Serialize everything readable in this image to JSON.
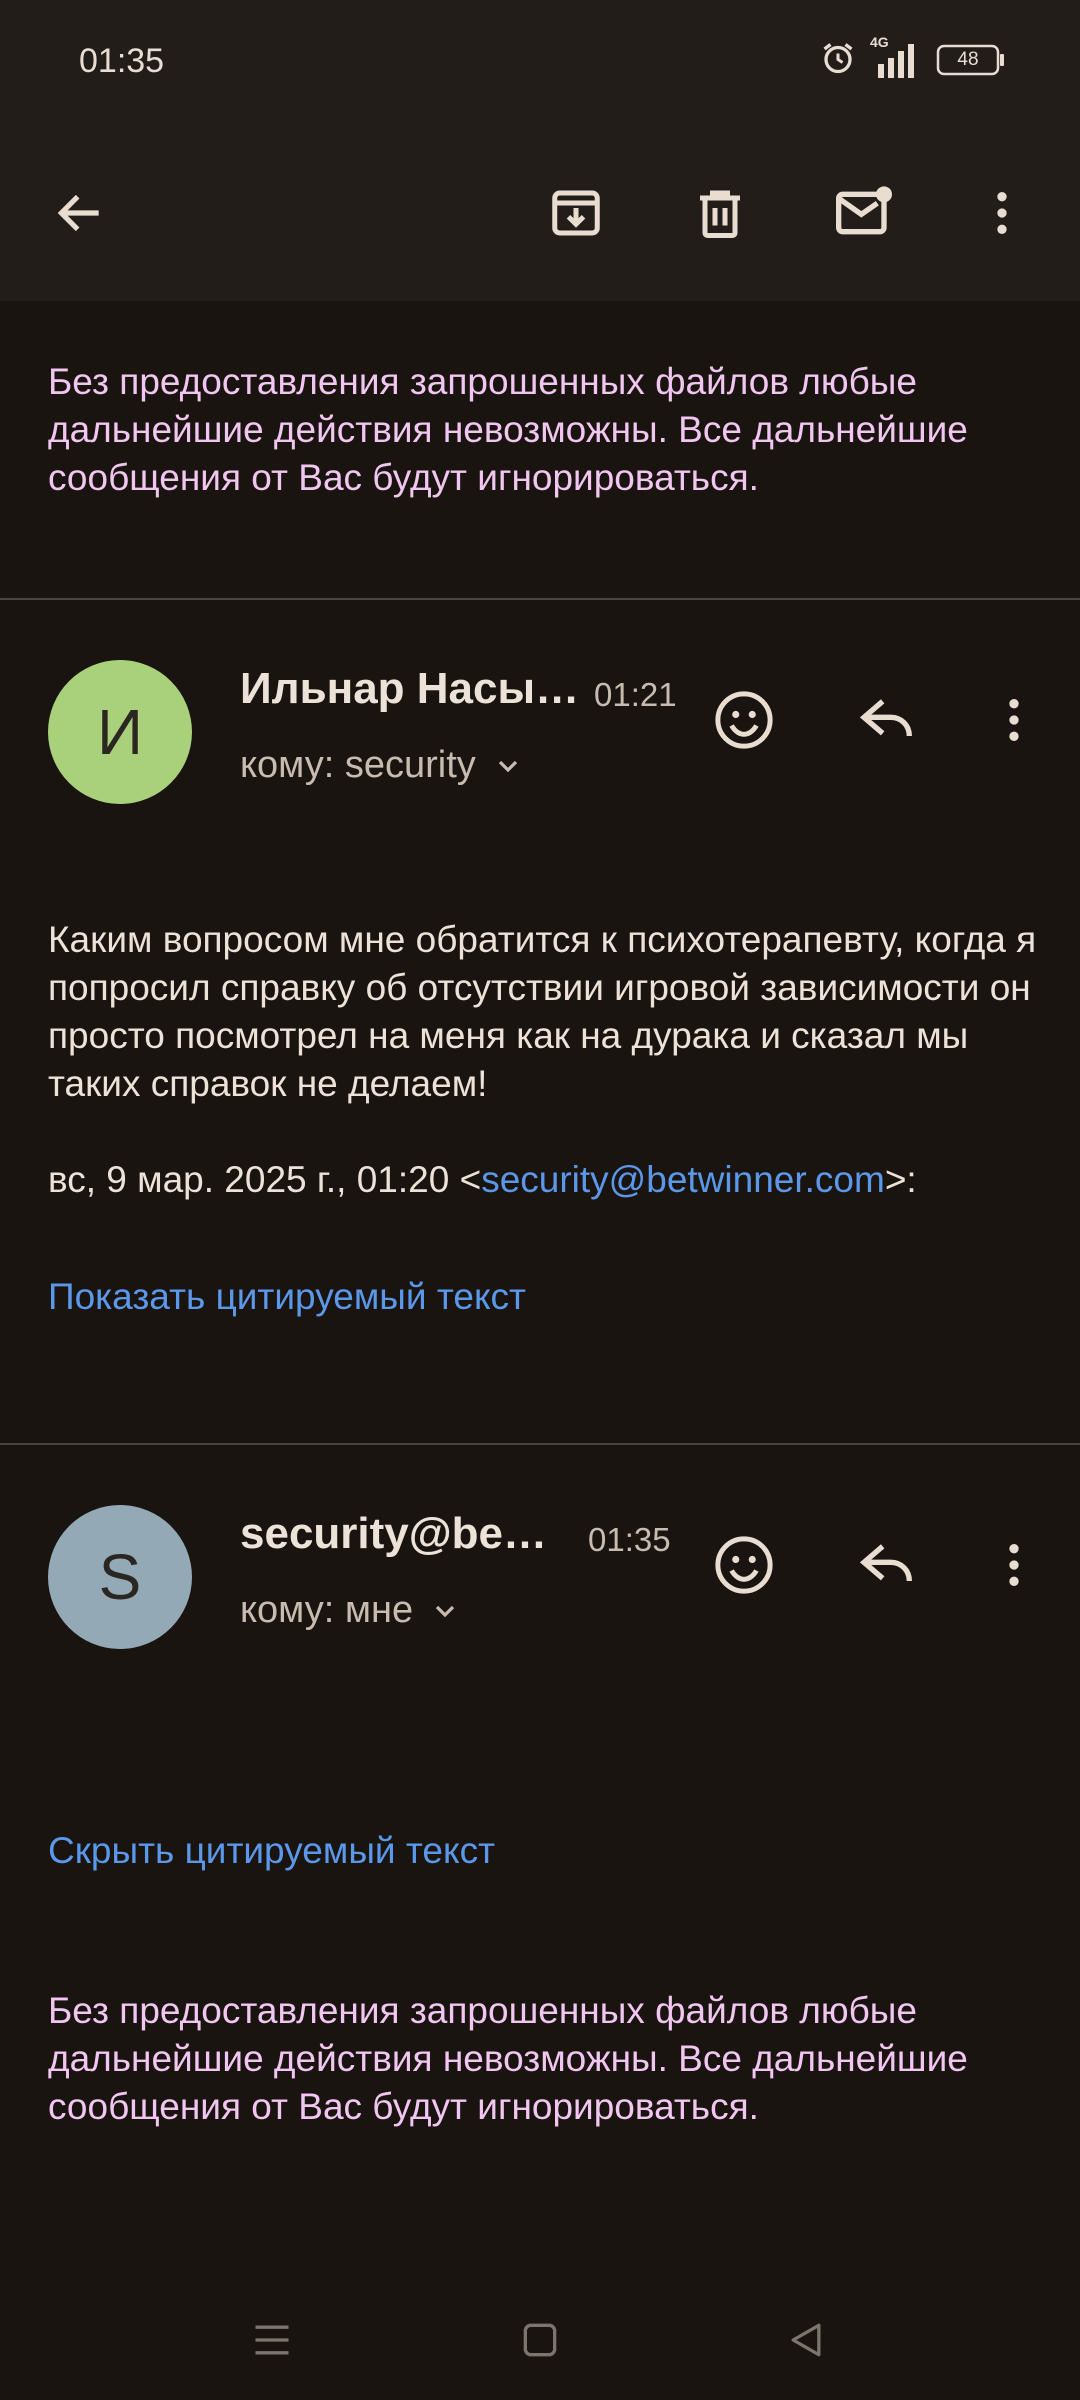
{
  "status_bar": {
    "time": "01:35",
    "network": "4G",
    "battery": "48",
    "icons": [
      "alarm-icon",
      "signal-icon",
      "battery-icon"
    ]
  },
  "app_bar": {
    "icons": [
      "back-arrow-icon",
      "archive-icon",
      "trash-icon",
      "mark-unread-icon",
      "more-vert-icon"
    ]
  },
  "quoted_top": {
    "text": "Без предоставления запрошенных файлов любые дальнейшие действия невозможны. Все дальнейшие сообщения от Вас будут игнорироваться."
  },
  "messages": [
    {
      "avatar_letter": "И",
      "avatar_color": "#a9d17c",
      "sender": "Ильнар Насы…",
      "time": "01:21",
      "recipient": "кому: security",
      "body": "Каким вопросом мне обратится к психотерапевту, когда я попросил справку об отсутствии игровой зависимости он просто посмотрел на меня как на дурака и сказал мы таких справок не делаем!",
      "quote_header_prefix": "вс, 9 мар. 2025 г., 01:20 <",
      "quote_header_email": "security@betwinner.com",
      "quote_header_suffix": ">:",
      "quote_toggle": "Показать цитируемый текст"
    },
    {
      "avatar_letter": "S",
      "avatar_color": "#93a9b6",
      "sender": "security@be…",
      "time": "01:35",
      "recipient": "кому: мне",
      "quote_toggle": "Скрыть цитируемый текст",
      "quoted_text": "Без предоставления запрошенных файлов любые дальнейшие действия невозможны. Все дальнейшие сообщения от Вас будут игнорироваться."
    }
  ],
  "colors": {
    "background": "#1a1410",
    "toolbar": "#221d19",
    "link": "#5b98ea",
    "quoted_text": "#f1c6f0"
  }
}
